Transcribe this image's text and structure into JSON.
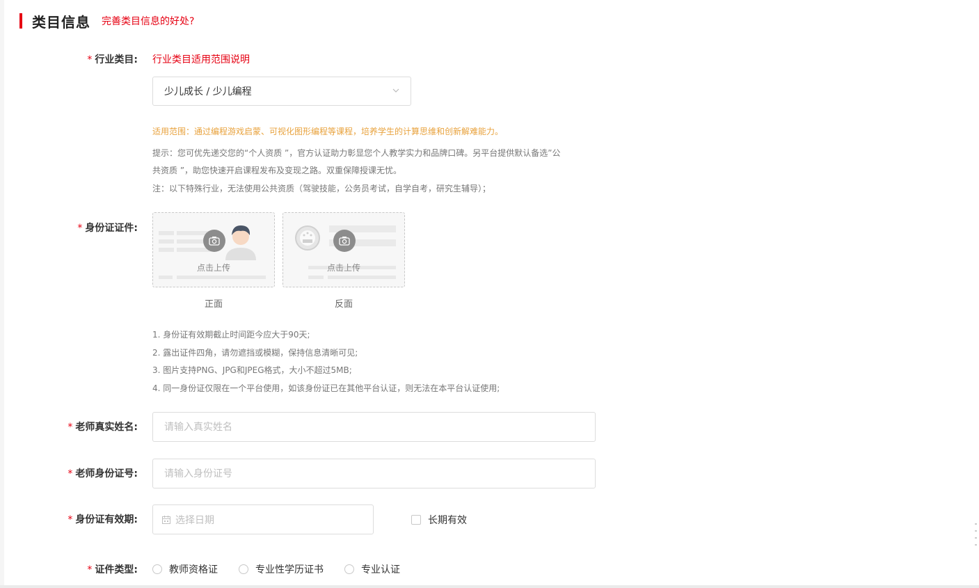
{
  "section": {
    "title": "类目信息",
    "link": "完善类目信息的好处?"
  },
  "industry": {
    "label": "行业类目:",
    "scope_link": "行业类目适用范围说明",
    "selected": "少儿成长 / 少儿编程",
    "scope_note": "适用范围：通过编程游戏启蒙、可视化图形编程等课程，培养学生的计算思维和创新解难能力。",
    "tip_line1": "提示：您可优先递交您的“个人资质 ”，官方认证助力彰显您个人教学实力和品牌口碑。另平台提供默认备选”公",
    "tip_line2": "共资质 ”，助您快速开启课程发布及变现之路。双重保障授课无忧。",
    "tip_line3": "注：以下特殊行业，无法使用公共资质（驾驶技能，公务员考试，自学自考，研究生辅导）；"
  },
  "id_card": {
    "label": "身份证证件:",
    "upload_text": "点击上传",
    "front_caption": "正面",
    "back_caption": "反面",
    "rules": [
      "1. 身份证有效期截止时间距今应大于90天;",
      "2. 露出证件四角，请勿遮挡或模糊，保持信息清晰可见;",
      "3. 图片支持PNG、JPG和JPEG格式，大小不超过5MB;",
      "4. 同一身份证仅限在一个平台使用，如该身份证已在其他平台认证，则无法在本平台认证使用;"
    ]
  },
  "teacher_name": {
    "label": "老师真实姓名:",
    "placeholder": "请输入真实姓名"
  },
  "teacher_id": {
    "label": "老师身份证号:",
    "placeholder": "请输入身份证号"
  },
  "validity": {
    "label": "身份证有效期:",
    "placeholder": "选择日期",
    "long_term": "长期有效"
  },
  "cert_type": {
    "label": "证件类型:",
    "options": [
      "教师资格证",
      "专业性学历证书",
      "专业认证"
    ]
  },
  "required_mark": "*",
  "colors": {
    "accent_red": "#e60012",
    "note_orange": "#e8a23d"
  }
}
